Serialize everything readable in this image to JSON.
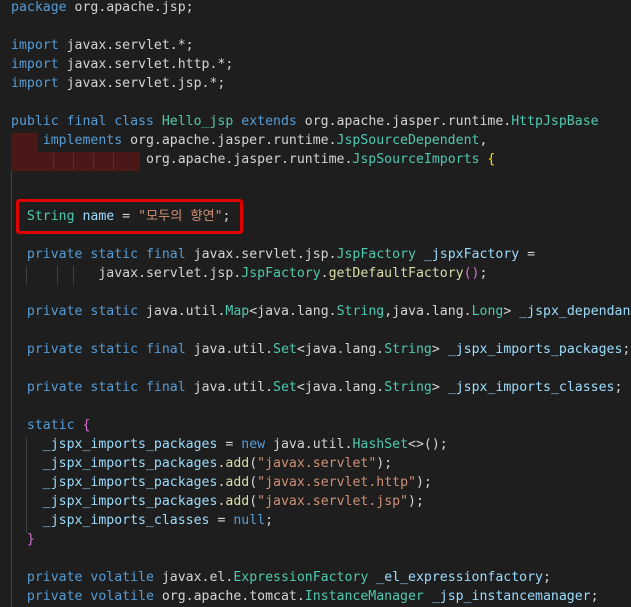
{
  "code_lines": [
    [
      {
        "t": "package ",
        "c": "kw"
      },
      {
        "t": "org.apache.jsp;",
        "c": "pn"
      }
    ],
    [],
    [
      {
        "t": "import ",
        "c": "kw"
      },
      {
        "t": "javax.servlet.*;",
        "c": "pn"
      }
    ],
    [
      {
        "t": "import ",
        "c": "kw"
      },
      {
        "t": "javax.servlet.http.*;",
        "c": "pn"
      }
    ],
    [
      {
        "t": "import ",
        "c": "kw"
      },
      {
        "t": "javax.servlet.jsp.*;",
        "c": "pn"
      }
    ],
    [],
    [
      {
        "t": "public final class ",
        "c": "kw"
      },
      {
        "t": "Hello_jsp ",
        "c": "ty"
      },
      {
        "t": "extends ",
        "c": "kw"
      },
      {
        "t": "org.apache.jasper.runtime.",
        "c": "pn"
      },
      {
        "t": "HttpJspBase",
        "c": "ty"
      }
    ],
    [
      {
        "t": "    implements ",
        "c": "kw"
      },
      {
        "t": "org.apache.jasper.runtime.",
        "c": "pn"
      },
      {
        "t": "JspSourceDependent",
        "c": "ty"
      },
      {
        "t": ",",
        "c": "pn"
      }
    ],
    [
      {
        "t": "                 ",
        "c": "pn"
      },
      {
        "t": "org.apache.jasper.runtime.",
        "c": "pn"
      },
      {
        "t": "JspSourceImports ",
        "c": "ty"
      },
      {
        "t": "{",
        "c": "br"
      }
    ],
    [],
    [],
    [
      {
        "t": "  String ",
        "c": "ty"
      },
      {
        "t": "name",
        "c": "vr"
      },
      {
        "t": " = ",
        "c": "pn"
      },
      {
        "t": "\"모두의 향연\"",
        "c": "st"
      },
      {
        "t": ";",
        "c": "pn"
      }
    ],
    [],
    [
      {
        "t": "  private static final ",
        "c": "kw"
      },
      {
        "t": "javax.servlet.jsp.",
        "c": "pn"
      },
      {
        "t": "JspFactory ",
        "c": "ty"
      },
      {
        "t": "_jspxFactory",
        "c": "vr"
      },
      {
        "t": " =",
        "c": "pn"
      }
    ],
    [
      {
        "t": "           javax.servlet.jsp.",
        "c": "pn"
      },
      {
        "t": "JspFactory",
        "c": "ty"
      },
      {
        "t": ".",
        "c": "pn"
      },
      {
        "t": "getDefaultFactory",
        "c": "fn"
      },
      {
        "t": "()",
        "c": "brv"
      },
      {
        "t": ";",
        "c": "pn"
      }
    ],
    [],
    [
      {
        "t": "  private static ",
        "c": "kw"
      },
      {
        "t": "java.util.",
        "c": "pn"
      },
      {
        "t": "Map",
        "c": "ty"
      },
      {
        "t": "<",
        "c": "pn"
      },
      {
        "t": "java.lang.",
        "c": "pn"
      },
      {
        "t": "String",
        "c": "ty"
      },
      {
        "t": ",",
        "c": "pn"
      },
      {
        "t": "java.lang.",
        "c": "pn"
      },
      {
        "t": "Long",
        "c": "ty"
      },
      {
        "t": "> ",
        "c": "pn"
      },
      {
        "t": "_jspx_dependants",
        "c": "vr"
      },
      {
        "t": ";",
        "c": "pn"
      }
    ],
    [],
    [
      {
        "t": "  private static final ",
        "c": "kw"
      },
      {
        "t": "java.util.",
        "c": "pn"
      },
      {
        "t": "Set",
        "c": "ty"
      },
      {
        "t": "<",
        "c": "pn"
      },
      {
        "t": "java.lang.",
        "c": "pn"
      },
      {
        "t": "String",
        "c": "ty"
      },
      {
        "t": "> ",
        "c": "pn"
      },
      {
        "t": "_jspx_imports_packages",
        "c": "vr"
      },
      {
        "t": ";",
        "c": "pn"
      }
    ],
    [],
    [
      {
        "t": "  private static final ",
        "c": "kw"
      },
      {
        "t": "java.util.",
        "c": "pn"
      },
      {
        "t": "Set",
        "c": "ty"
      },
      {
        "t": "<",
        "c": "pn"
      },
      {
        "t": "java.lang.",
        "c": "pn"
      },
      {
        "t": "String",
        "c": "ty"
      },
      {
        "t": "> ",
        "c": "pn"
      },
      {
        "t": "_jspx_imports_classes",
        "c": "vr"
      },
      {
        "t": ";",
        "c": "pn"
      }
    ],
    [],
    [
      {
        "t": "  static ",
        "c": "kw"
      },
      {
        "t": "{",
        "c": "brv"
      }
    ],
    [
      {
        "t": "    _jspx_imports_packages",
        "c": "vr"
      },
      {
        "t": " = ",
        "c": "pn"
      },
      {
        "t": "new ",
        "c": "kw"
      },
      {
        "t": "java.util.",
        "c": "pn"
      },
      {
        "t": "HashSet",
        "c": "ty"
      },
      {
        "t": "<>()",
        "c": "pn"
      },
      {
        "t": ";",
        "c": "pn"
      }
    ],
    [
      {
        "t": "    _jspx_imports_packages",
        "c": "vr"
      },
      {
        "t": ".",
        "c": "pn"
      },
      {
        "t": "add",
        "c": "fn"
      },
      {
        "t": "(",
        "c": "pn"
      },
      {
        "t": "\"javax.servlet\"",
        "c": "st"
      },
      {
        "t": ");",
        "c": "pn"
      }
    ],
    [
      {
        "t": "    _jspx_imports_packages",
        "c": "vr"
      },
      {
        "t": ".",
        "c": "pn"
      },
      {
        "t": "add",
        "c": "fn"
      },
      {
        "t": "(",
        "c": "pn"
      },
      {
        "t": "\"javax.servlet.http\"",
        "c": "st"
      },
      {
        "t": ");",
        "c": "pn"
      }
    ],
    [
      {
        "t": "    _jspx_imports_packages",
        "c": "vr"
      },
      {
        "t": ".",
        "c": "pn"
      },
      {
        "t": "add",
        "c": "fn"
      },
      {
        "t": "(",
        "c": "pn"
      },
      {
        "t": "\"javax.servlet.jsp\"",
        "c": "st"
      },
      {
        "t": ");",
        "c": "pn"
      }
    ],
    [
      {
        "t": "    _jspx_imports_classes",
        "c": "vr"
      },
      {
        "t": " = ",
        "c": "pn"
      },
      {
        "t": "null",
        "c": "kw"
      },
      {
        "t": ";",
        "c": "pn"
      }
    ],
    [
      {
        "t": "  }",
        "c": "brv"
      }
    ],
    [],
    [
      {
        "t": "  private volatile ",
        "c": "kw"
      },
      {
        "t": "javax.el.",
        "c": "pn"
      },
      {
        "t": "ExpressionFactory ",
        "c": "ty"
      },
      {
        "t": "_el_expressionfactory",
        "c": "vr"
      },
      {
        "t": ";",
        "c": "pn"
      }
    ],
    [
      {
        "t": "  private volatile ",
        "c": "kw"
      },
      {
        "t": "org.apache.tomcat.",
        "c": "pn"
      },
      {
        "t": "InstanceManager ",
        "c": "ty"
      },
      {
        "t": "_jsp_instancemanager",
        "c": "vr"
      },
      {
        "t": ";",
        "c": "pn"
      }
    ]
  ],
  "colors": {
    "background": "#1e1e1e",
    "keyword": "#569cd6",
    "type": "#4ec9b0",
    "variable": "#9cdcfe",
    "string": "#ce9178",
    "highlight_box": "#e00000"
  }
}
